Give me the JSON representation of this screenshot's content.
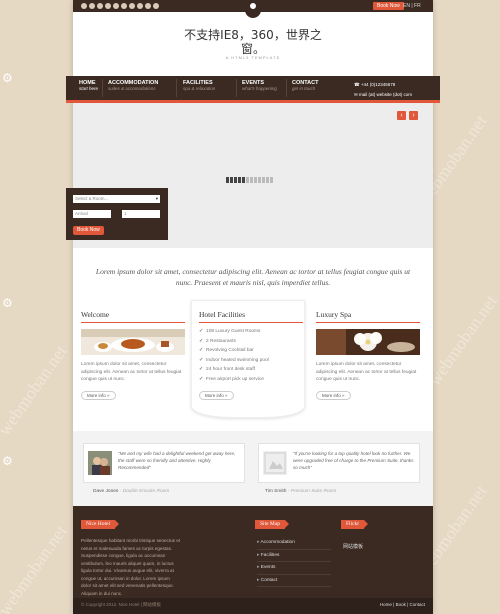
{
  "header": {
    "book_now": "Book Now",
    "lang": "EN | FR",
    "logo_line1": "不支持IE8，360，世界之",
    "logo_line2": "窗。",
    "tagline": "A HTML5 TEMPLATE"
  },
  "nav": {
    "items": [
      {
        "title": "HOME",
        "sub": "start here"
      },
      {
        "title": "ACCOMMODATION",
        "sub": "suites & accomodations"
      },
      {
        "title": "FACILITIES",
        "sub": "spa & relaxation"
      },
      {
        "title": "EVENTS",
        "sub": "what's happening"
      },
      {
        "title": "CONTACT",
        "sub": "get in touch"
      }
    ],
    "phone": "+44 (0)12345678",
    "email": "mail (at) website (dot) com"
  },
  "booking": {
    "select_room": "Select a Room...",
    "arrival": "Arrival",
    "nights": "1",
    "book_button": "Book Now"
  },
  "intro": "Lorem ipsum dolor sit amet, consectetur adipiscing elit. Aenean ac tortor at tellus feugiat congue quis ut nunc. Praesent et mauris nisl, quis imperdiet tellus.",
  "columns": {
    "welcome": {
      "title": "Welcome",
      "text": "Lorem ipsum dolor sit amet, consectetur adipiscing elit. Aenean ac tortor at tellus feugiat congue quis ut nunc.",
      "more": "More info »"
    },
    "facilities": {
      "title": "Hotel Facilities",
      "items": [
        "108 Luxury Guest Rooms",
        "2 Restaurants",
        "Revolving Cocktail bar",
        "Indoor heated swimming pool",
        "24 hour front desk staff",
        "Free airport pick up service"
      ],
      "more": "More info »"
    },
    "spa": {
      "title": "Luxury Spa",
      "text": "Lorem ipsum dolor sit amet, consectetur adipiscing elit. Aenean ac tortor at tellus feugiat congue quis ut nunc.",
      "more": "More info »"
    }
  },
  "testimonials": [
    {
      "quote": "\"Me and my wife had a delightful weekend get away here, the staff were so friendly and attentive. Highly Recommended\"",
      "name": "Dave Jones",
      "suite": "- Double Ensuite Room"
    },
    {
      "quote": "\"If you're looking for a top quality hotel look no further. We were upgraded free of charge to the Premium Suite, thanks so much\"",
      "name": "Tim Smith",
      "suite": "- Premium Suite Room"
    }
  ],
  "footer": {
    "about_title": "Nice Hotel",
    "about_text": "Pellentesque habitant morbi tristique senectus et netus et malesuada fames ac turpis egestas. Suspendisse congue, ligula ac accumsan vestibulum, leo mauris aliquet quam, in luctus ligula tortor dui. Vivamus augue elit, viverra at congue ut, accumsan in dolor. Lorem ipsum dolor sit amet elit sed venenatis pellentesque. Aliquam in dui nunc.",
    "sitemap_title": "Site Map",
    "sitemap": [
      "Accommodation",
      "Facilities",
      "Events",
      "Contact"
    ],
    "flickr_title": "Flickr",
    "flickr_text": "网站模板",
    "copyright": "© Copyright 2012. Nice Hotel | 网站模板",
    "links": "Home | Book | Contact"
  },
  "colors": {
    "accent": "#e0573a",
    "dark": "#3a2a22",
    "page_bg": "#e6d9c4"
  }
}
